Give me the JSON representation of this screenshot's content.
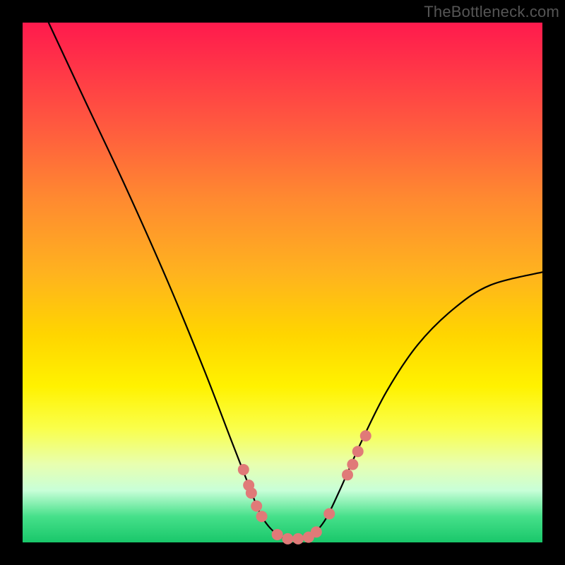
{
  "watermark": "TheBottleneck.com",
  "chart_data": {
    "type": "line",
    "title": "",
    "xlabel": "",
    "ylabel": "",
    "xlim": [
      0,
      100
    ],
    "ylim": [
      0,
      100
    ],
    "series": [
      {
        "name": "curve",
        "x": [
          5,
          12,
          20,
          28,
          35,
          40,
          43.5,
          46,
          49,
          52,
          55,
          58,
          61,
          65,
          70,
          76,
          83,
          90,
          100
        ],
        "y": [
          100,
          85,
          68,
          50,
          33,
          20,
          11,
          5,
          1.5,
          0.5,
          1,
          4,
          10,
          19,
          29,
          38,
          45,
          49.5,
          52
        ]
      }
    ],
    "salmon_dots": {
      "name": "markers",
      "points": [
        [
          42.5,
          14
        ],
        [
          43.5,
          11
        ],
        [
          44.0,
          9.5
        ],
        [
          45.0,
          7
        ],
        [
          46.0,
          5
        ],
        [
          49.0,
          1.5
        ],
        [
          51.0,
          0.7
        ],
        [
          53.0,
          0.7
        ],
        [
          55.0,
          1.0
        ],
        [
          56.5,
          2.0
        ],
        [
          59.0,
          5.5
        ],
        [
          62.5,
          13
        ],
        [
          63.5,
          15
        ],
        [
          64.5,
          17.5
        ],
        [
          66.0,
          20.5
        ]
      ]
    },
    "colors": {
      "curve": "#000000",
      "dots": "#e07a78"
    }
  }
}
